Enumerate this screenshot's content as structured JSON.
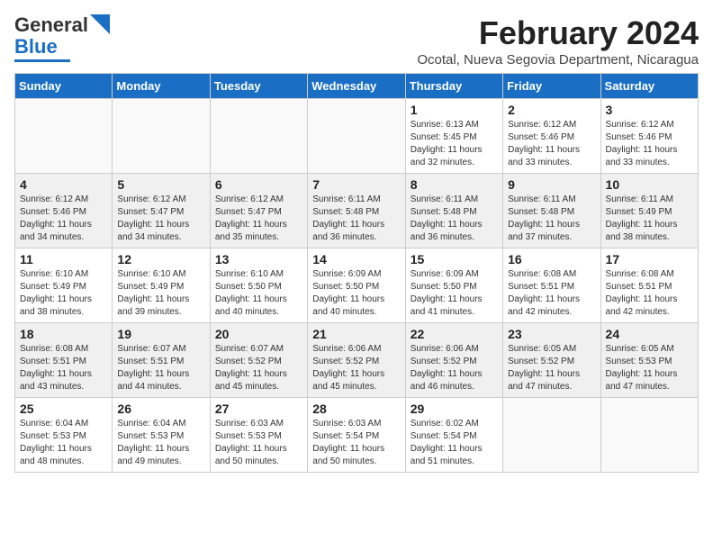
{
  "logo": {
    "line1": "General",
    "line2": "Blue"
  },
  "title": "February 2024",
  "subtitle": "Ocotal, Nueva Segovia Department, Nicaragua",
  "weekdays": [
    "Sunday",
    "Monday",
    "Tuesday",
    "Wednesday",
    "Thursday",
    "Friday",
    "Saturday"
  ],
  "weeks": [
    [
      {
        "day": "",
        "sunrise": "",
        "sunset": "",
        "daylight": ""
      },
      {
        "day": "",
        "sunrise": "",
        "sunset": "",
        "daylight": ""
      },
      {
        "day": "",
        "sunrise": "",
        "sunset": "",
        "daylight": ""
      },
      {
        "day": "",
        "sunrise": "",
        "sunset": "",
        "daylight": ""
      },
      {
        "day": "1",
        "sunrise": "Sunrise: 6:13 AM",
        "sunset": "Sunset: 5:45 PM",
        "daylight": "Daylight: 11 hours and 32 minutes."
      },
      {
        "day": "2",
        "sunrise": "Sunrise: 6:12 AM",
        "sunset": "Sunset: 5:46 PM",
        "daylight": "Daylight: 11 hours and 33 minutes."
      },
      {
        "day": "3",
        "sunrise": "Sunrise: 6:12 AM",
        "sunset": "Sunset: 5:46 PM",
        "daylight": "Daylight: 11 hours and 33 minutes."
      }
    ],
    [
      {
        "day": "4",
        "sunrise": "Sunrise: 6:12 AM",
        "sunset": "Sunset: 5:46 PM",
        "daylight": "Daylight: 11 hours and 34 minutes."
      },
      {
        "day": "5",
        "sunrise": "Sunrise: 6:12 AM",
        "sunset": "Sunset: 5:47 PM",
        "daylight": "Daylight: 11 hours and 34 minutes."
      },
      {
        "day": "6",
        "sunrise": "Sunrise: 6:12 AM",
        "sunset": "Sunset: 5:47 PM",
        "daylight": "Daylight: 11 hours and 35 minutes."
      },
      {
        "day": "7",
        "sunrise": "Sunrise: 6:11 AM",
        "sunset": "Sunset: 5:48 PM",
        "daylight": "Daylight: 11 hours and 36 minutes."
      },
      {
        "day": "8",
        "sunrise": "Sunrise: 6:11 AM",
        "sunset": "Sunset: 5:48 PM",
        "daylight": "Daylight: 11 hours and 36 minutes."
      },
      {
        "day": "9",
        "sunrise": "Sunrise: 6:11 AM",
        "sunset": "Sunset: 5:48 PM",
        "daylight": "Daylight: 11 hours and 37 minutes."
      },
      {
        "day": "10",
        "sunrise": "Sunrise: 6:11 AM",
        "sunset": "Sunset: 5:49 PM",
        "daylight": "Daylight: 11 hours and 38 minutes."
      }
    ],
    [
      {
        "day": "11",
        "sunrise": "Sunrise: 6:10 AM",
        "sunset": "Sunset: 5:49 PM",
        "daylight": "Daylight: 11 hours and 38 minutes."
      },
      {
        "day": "12",
        "sunrise": "Sunrise: 6:10 AM",
        "sunset": "Sunset: 5:49 PM",
        "daylight": "Daylight: 11 hours and 39 minutes."
      },
      {
        "day": "13",
        "sunrise": "Sunrise: 6:10 AM",
        "sunset": "Sunset: 5:50 PM",
        "daylight": "Daylight: 11 hours and 40 minutes."
      },
      {
        "day": "14",
        "sunrise": "Sunrise: 6:09 AM",
        "sunset": "Sunset: 5:50 PM",
        "daylight": "Daylight: 11 hours and 40 minutes."
      },
      {
        "day": "15",
        "sunrise": "Sunrise: 6:09 AM",
        "sunset": "Sunset: 5:50 PM",
        "daylight": "Daylight: 11 hours and 41 minutes."
      },
      {
        "day": "16",
        "sunrise": "Sunrise: 6:08 AM",
        "sunset": "Sunset: 5:51 PM",
        "daylight": "Daylight: 11 hours and 42 minutes."
      },
      {
        "day": "17",
        "sunrise": "Sunrise: 6:08 AM",
        "sunset": "Sunset: 5:51 PM",
        "daylight": "Daylight: 11 hours and 42 minutes."
      }
    ],
    [
      {
        "day": "18",
        "sunrise": "Sunrise: 6:08 AM",
        "sunset": "Sunset: 5:51 PM",
        "daylight": "Daylight: 11 hours and 43 minutes."
      },
      {
        "day": "19",
        "sunrise": "Sunrise: 6:07 AM",
        "sunset": "Sunset: 5:51 PM",
        "daylight": "Daylight: 11 hours and 44 minutes."
      },
      {
        "day": "20",
        "sunrise": "Sunrise: 6:07 AM",
        "sunset": "Sunset: 5:52 PM",
        "daylight": "Daylight: 11 hours and 45 minutes."
      },
      {
        "day": "21",
        "sunrise": "Sunrise: 6:06 AM",
        "sunset": "Sunset: 5:52 PM",
        "daylight": "Daylight: 11 hours and 45 minutes."
      },
      {
        "day": "22",
        "sunrise": "Sunrise: 6:06 AM",
        "sunset": "Sunset: 5:52 PM",
        "daylight": "Daylight: 11 hours and 46 minutes."
      },
      {
        "day": "23",
        "sunrise": "Sunrise: 6:05 AM",
        "sunset": "Sunset: 5:52 PM",
        "daylight": "Daylight: 11 hours and 47 minutes."
      },
      {
        "day": "24",
        "sunrise": "Sunrise: 6:05 AM",
        "sunset": "Sunset: 5:53 PM",
        "daylight": "Daylight: 11 hours and 47 minutes."
      }
    ],
    [
      {
        "day": "25",
        "sunrise": "Sunrise: 6:04 AM",
        "sunset": "Sunset: 5:53 PM",
        "daylight": "Daylight: 11 hours and 48 minutes."
      },
      {
        "day": "26",
        "sunrise": "Sunrise: 6:04 AM",
        "sunset": "Sunset: 5:53 PM",
        "daylight": "Daylight: 11 hours and 49 minutes."
      },
      {
        "day": "27",
        "sunrise": "Sunrise: 6:03 AM",
        "sunset": "Sunset: 5:53 PM",
        "daylight": "Daylight: 11 hours and 50 minutes."
      },
      {
        "day": "28",
        "sunrise": "Sunrise: 6:03 AM",
        "sunset": "Sunset: 5:54 PM",
        "daylight": "Daylight: 11 hours and 50 minutes."
      },
      {
        "day": "29",
        "sunrise": "Sunrise: 6:02 AM",
        "sunset": "Sunset: 5:54 PM",
        "daylight": "Daylight: 11 hours and 51 minutes."
      },
      {
        "day": "",
        "sunrise": "",
        "sunset": "",
        "daylight": ""
      },
      {
        "day": "",
        "sunrise": "",
        "sunset": "",
        "daylight": ""
      }
    ]
  ]
}
